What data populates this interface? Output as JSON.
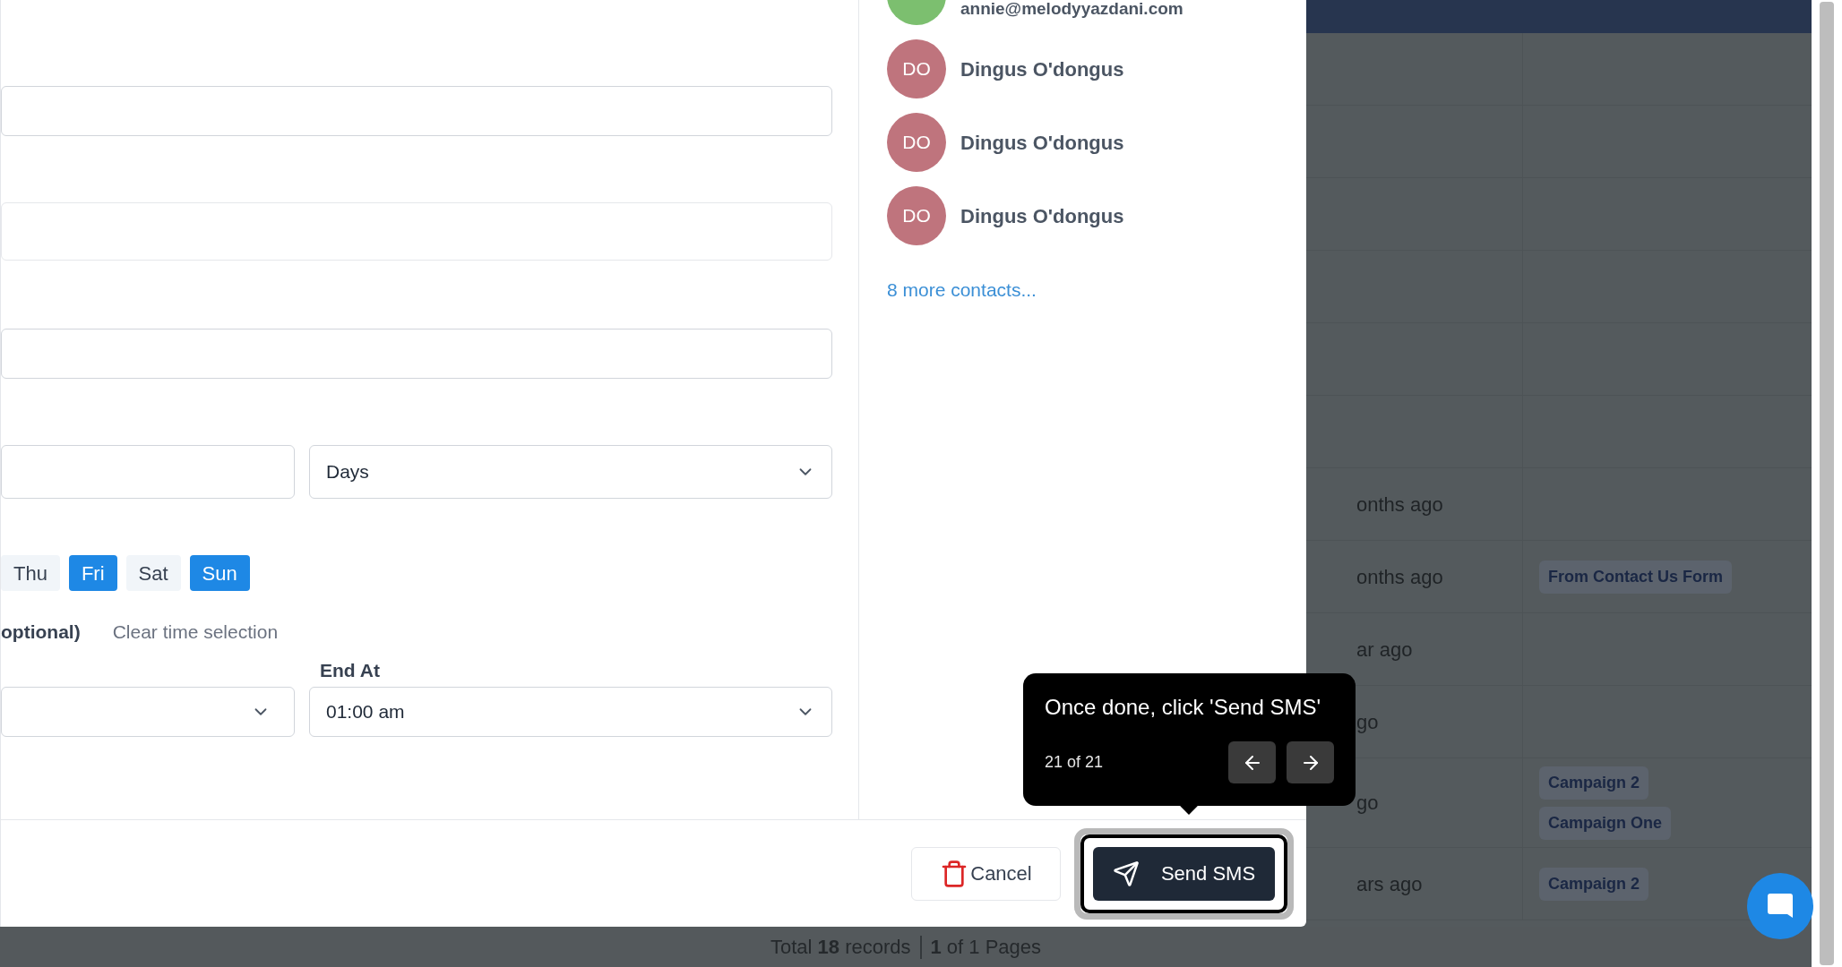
{
  "contacts": [
    {
      "name": "annie@melodyyazdani.com",
      "color": "#7cbf6f"
    },
    {
      "initials": "DO",
      "name": "Dingus O'dongus",
      "color": "#bf747d"
    },
    {
      "initials": "DO",
      "name": "Dingus O'dongus",
      "color": "#bf747d"
    },
    {
      "initials": "DO",
      "name": "Dingus O'dongus",
      "color": "#bf747d"
    }
  ],
  "more_contacts": "8 more contacts...",
  "form": {
    "interval_unit": "Days",
    "days": [
      {
        "label": "Thu",
        "selected": false
      },
      {
        "label": "Fri",
        "selected": true
      },
      {
        "label": "Sat",
        "selected": false
      },
      {
        "label": "Sun",
        "selected": true
      }
    ],
    "time_label": "optional)",
    "clear_time": "Clear time selection",
    "end_at": {
      "label": "End At",
      "value": "01:00 am"
    }
  },
  "footer": {
    "cancel": "Cancel",
    "send": "Send SMS"
  },
  "tour": {
    "text": "Once done, click 'Send SMS'",
    "step": "21 of 21"
  },
  "table": {
    "rows": [
      {
        "column_1": "onths ago"
      },
      {
        "column_1": "onths ago",
        "tags": [
          "From Contact Us Form"
        ]
      },
      {
        "column_1": "ar ago"
      },
      {
        "column_1": "go"
      },
      {
        "column_1": "go",
        "tags": [
          "Campaign 2",
          "Campaign One"
        ]
      },
      {
        "column_1": "ars ago",
        "tags": [
          "Campaign 2"
        ]
      }
    ]
  },
  "pagination": [
    "Total **18** records",
    "**1** of 1 Pages"
  ]
}
